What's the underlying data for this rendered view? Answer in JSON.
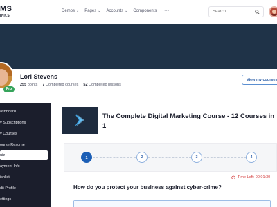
{
  "header": {
    "logo_big": "MS",
    "logo_small": "INKS",
    "nav": [
      {
        "label": "Demos",
        "has_dropdown": true
      },
      {
        "label": "Pages",
        "has_dropdown": true
      },
      {
        "label": "Accounts",
        "has_dropdown": true
      },
      {
        "label": "Components",
        "has_dropdown": false
      }
    ],
    "more_label": "···",
    "search_placeholder": "Search"
  },
  "profile": {
    "name": "Lori Stevens",
    "badge": "Pro",
    "stats": [
      {
        "value": "255",
        "label": "points"
      },
      {
        "value": "7",
        "label": "Completed courses"
      },
      {
        "value": "52",
        "label": "Completed lessons"
      }
    ],
    "view_courses_label": "View my courses"
  },
  "sidebar": {
    "items": [
      {
        "label": "ashboard",
        "active": false
      },
      {
        "label": "y Subscriptions",
        "active": false
      },
      {
        "label": "y Courses",
        "active": false
      },
      {
        "label": "ourse Resume",
        "active": false
      },
      {
        "label": "uiz",
        "active": true
      },
      {
        "label": "ayment Info",
        "active": false
      },
      {
        "label": "ishlist",
        "active": false
      },
      {
        "label": "dit Profile",
        "active": false
      },
      {
        "label": "ettings",
        "active": false
      }
    ]
  },
  "course": {
    "title": "The Complete Digital Marketing Course - 12 Courses in 1"
  },
  "steps": [
    {
      "number": "1",
      "state": "done"
    },
    {
      "number": "2",
      "state": "pending"
    },
    {
      "number": "3",
      "state": "pending"
    },
    {
      "number": "4",
      "state": "pending"
    }
  ],
  "timer": {
    "label": "Time Left: 00:01:30"
  },
  "quiz": {
    "question": "How do you protect your business against cyber-crime?"
  },
  "colors": {
    "primary": "#1c5fb6",
    "sidebar_bg": "#1b1e2c",
    "cover_bg": "#1f3348",
    "timer_red": "#d33b3b",
    "badge_green": "#36a45b"
  }
}
